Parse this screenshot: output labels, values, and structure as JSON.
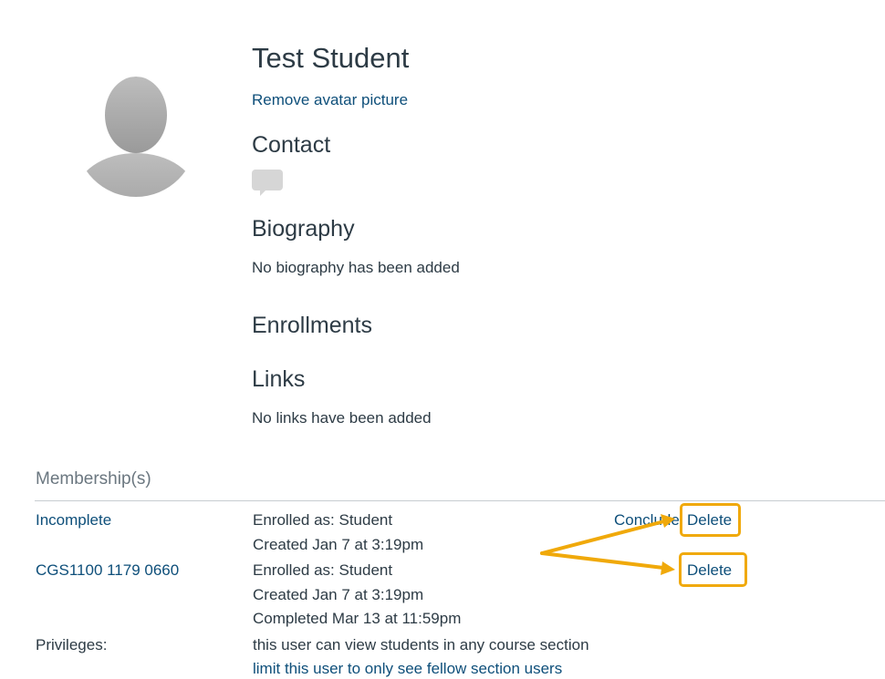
{
  "profile": {
    "name": "Test Student",
    "remove_avatar_label": "Remove avatar picture",
    "contact_heading": "Contact",
    "contact_icon": "message-bubble-icon",
    "biography_heading": "Biography",
    "biography_text": "No biography has been added",
    "enrollments_heading": "Enrollments",
    "links_heading": "Links",
    "links_text": "No links have been added"
  },
  "membership": {
    "heading": "Membership(s)",
    "rows": [
      {
        "name": "Incomplete",
        "enrolled_as": "Enrolled as: Student",
        "created": "Created Jan 7 at 3:19pm",
        "conclude_label": "Conclude",
        "delete_label": "Delete"
      },
      {
        "name": "CGS1100 1179 0660",
        "enrolled_as": "Enrolled as: Student",
        "created": "Created Jan 7 at 3:19pm",
        "completed": "Completed Mar 13 at 11:59pm",
        "delete_label": "Delete"
      }
    ],
    "privileges_label": "Privileges:",
    "privileges_text": "this user can view students in any course section",
    "privileges_link": "limit this user to only see fellow section users"
  },
  "colors": {
    "link": "#0e4f7a",
    "text": "#2d3b45",
    "muted": "#6b7780",
    "annotation": "#f0a90a"
  }
}
